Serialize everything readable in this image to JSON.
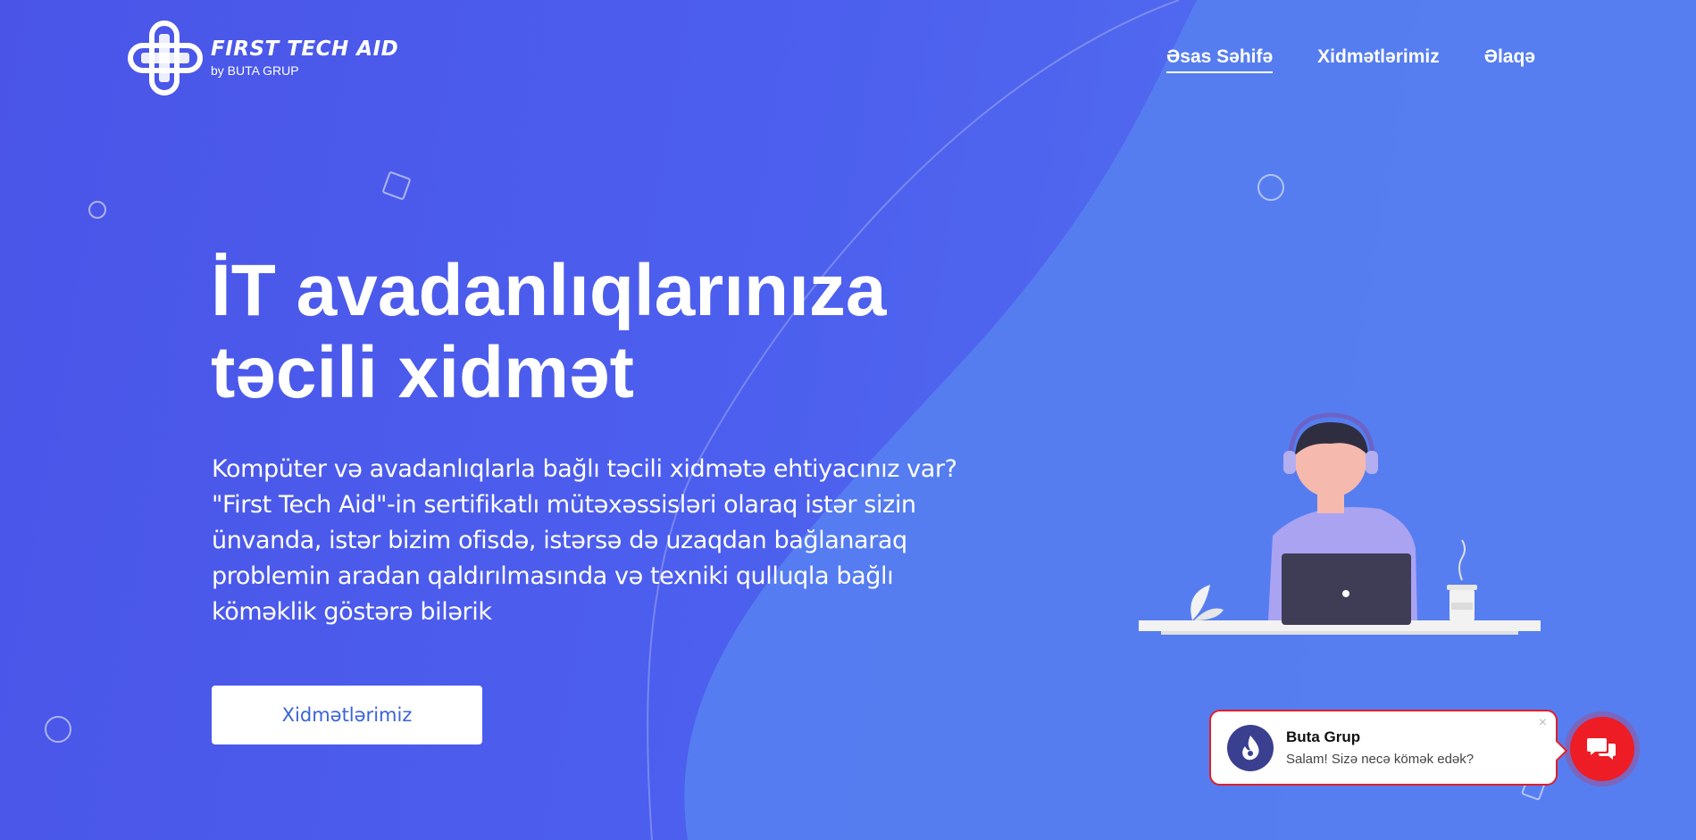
{
  "header": {
    "logo_title": "FIRST TECH AID",
    "logo_sub": "by BUTA GRUP",
    "nav": [
      {
        "label": "Əsas Səhifə",
        "active": true
      },
      {
        "label": "Xidmətlərimiz",
        "active": false
      },
      {
        "label": "Əlaqə",
        "active": false
      }
    ]
  },
  "hero": {
    "title_line1": "İT avadanlıqlarınıza",
    "title_line2": "təcili xidmət",
    "description": "Kompüter və avadanlıqlarla bağlı təcili xidmətə ehtiyacınız var? \"First Tech Aid\"-in sertifikatlı mütəxəssisləri olaraq istər sizin ünvanda, istər bizim ofisdə, istərsə də uzaqdan bağlanaraq problemin aradan qaldırılmasında və texniki qulluqla bağlı köməklik göstərə bilərik",
    "cta_label": "Xidmətlərimiz"
  },
  "chat": {
    "name": "Buta Grup",
    "message": "Salam! Sizə necə kömək edək?",
    "close_glyph": "×"
  },
  "colors": {
    "background_start": "#4a55e8",
    "background_end": "#5776f0",
    "cta_text": "#3a63d8",
    "chat_red": "#ee1c25"
  },
  "icons": {
    "logo": "medical-cross-logo-icon",
    "chat_avatar": "buta-flame-icon",
    "chat_button": "chat-bubbles-icon",
    "close": "close-icon"
  }
}
